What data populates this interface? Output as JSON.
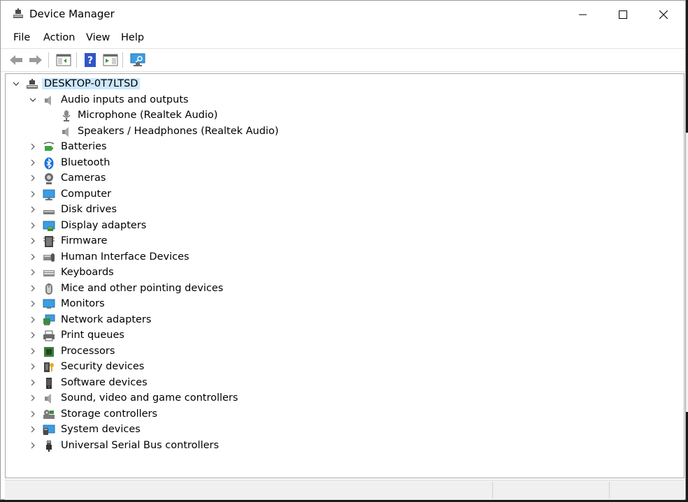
{
  "window": {
    "title": "Device Manager"
  },
  "menu": [
    "File",
    "Action",
    "View",
    "Help"
  ],
  "toolbar": {
    "buttons": [
      "back-icon",
      "forward-icon",
      "properties-icon",
      "help-icon",
      "update-driver-icon",
      "scan-hardware-icon"
    ]
  },
  "tree": {
    "root": "DESKTOP-0T7LTSD",
    "audio": {
      "label": "Audio inputs and outputs",
      "children": [
        "Microphone (Realtek Audio)",
        "Speakers / Headphones (Realtek Audio)"
      ]
    },
    "categories": [
      "Batteries",
      "Bluetooth",
      "Cameras",
      "Computer",
      "Disk drives",
      "Display adapters",
      "Firmware",
      "Human Interface Devices",
      "Keyboards",
      "Mice and other pointing devices",
      "Monitors",
      "Network adapters",
      "Print queues",
      "Processors",
      "Security devices",
      "Software devices",
      "Sound, video and game controllers",
      "Storage controllers",
      "System devices",
      "Universal Serial Bus controllers"
    ]
  },
  "colors": {
    "selection": "#cce8ff",
    "monitor_blue": "#3a9ee4",
    "bluetooth_blue": "#1a73d9"
  }
}
